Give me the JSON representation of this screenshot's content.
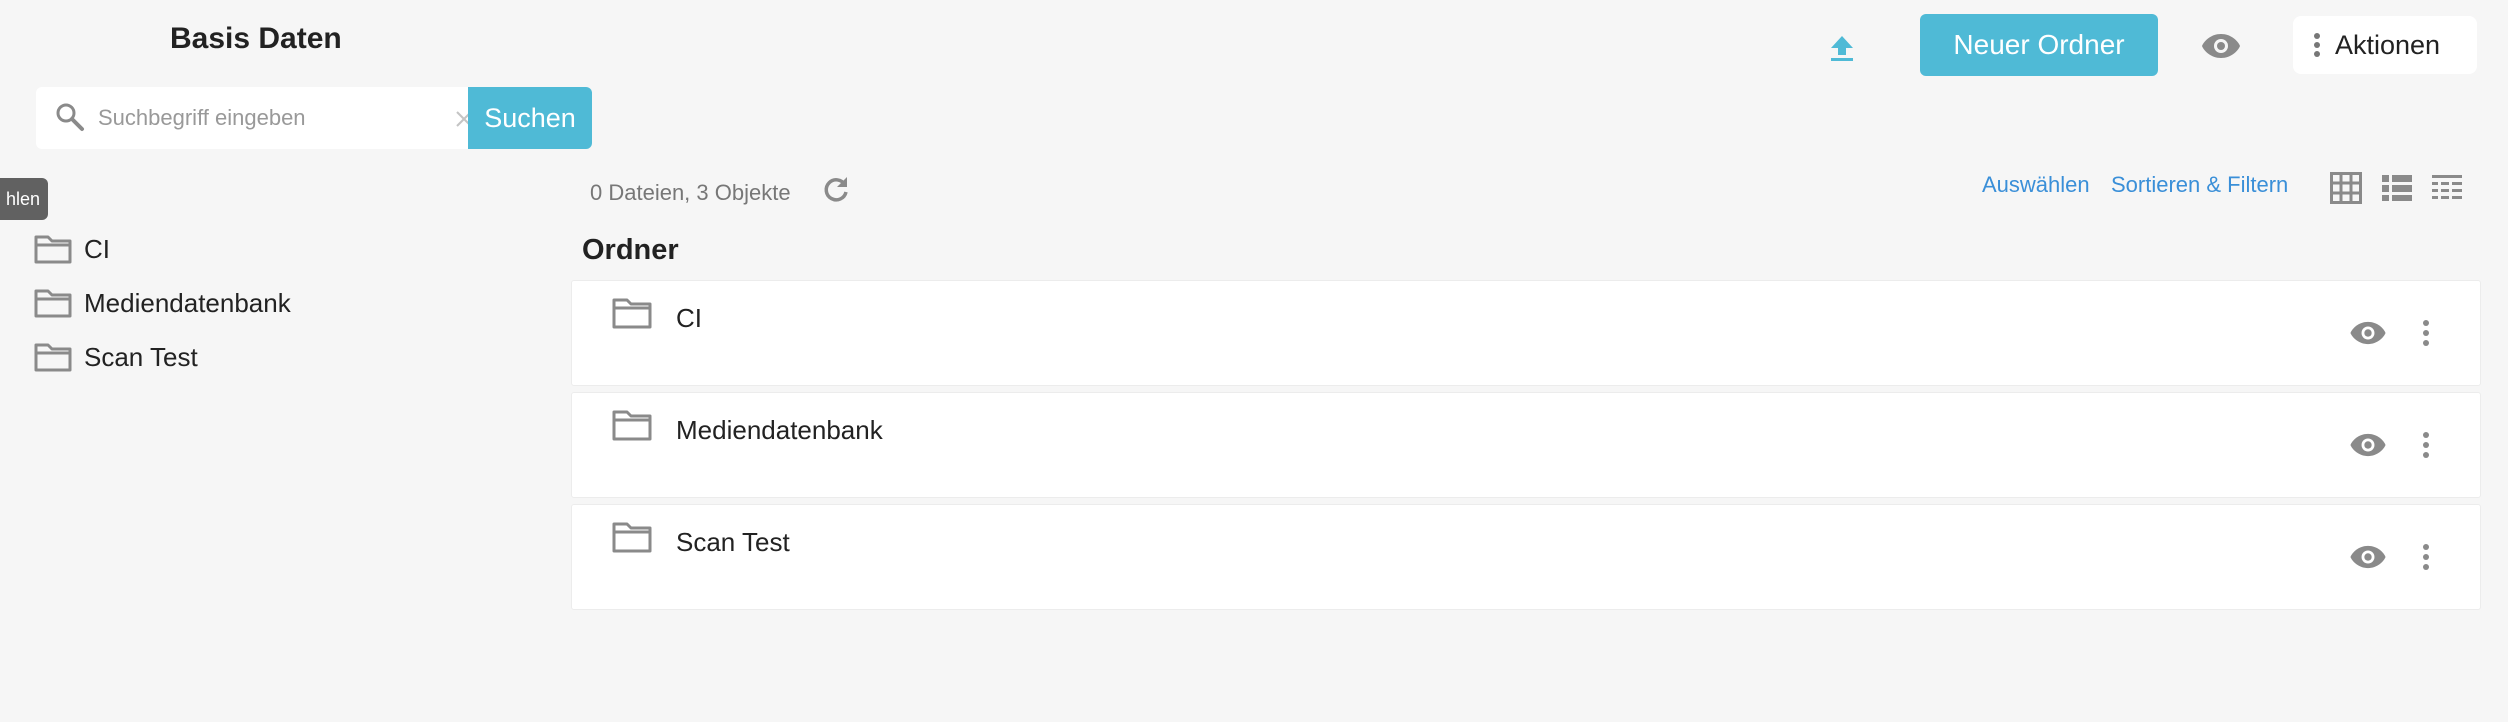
{
  "header": {
    "title": "Basis Daten",
    "upload_icon": "upload-icon",
    "new_folder_label": "Neuer Ordner",
    "actions_label": "Aktionen",
    "accent_color": "#4fbad6"
  },
  "search": {
    "placeholder": "Suchbegriff eingeben",
    "value": "",
    "button_label": "Suchen"
  },
  "tooltip": {
    "text": "hlen"
  },
  "sidebar": {
    "items": [
      {
        "label": "CI",
        "icon": "folder-icon"
      },
      {
        "label": "Mediendatenbank",
        "icon": "folder-icon"
      },
      {
        "label": "Scan Test",
        "icon": "folder-icon"
      }
    ]
  },
  "main": {
    "count_text": "0 Dateien, 3 Objekte",
    "select_link": "Auswählen",
    "sort_filter_link": "Sortieren & Filtern",
    "section_heading": "Ordner",
    "link_color": "#3a8fd8",
    "folders": [
      {
        "name": "CI"
      },
      {
        "name": "Mediendatenbank"
      },
      {
        "name": "Scan Test"
      }
    ]
  }
}
